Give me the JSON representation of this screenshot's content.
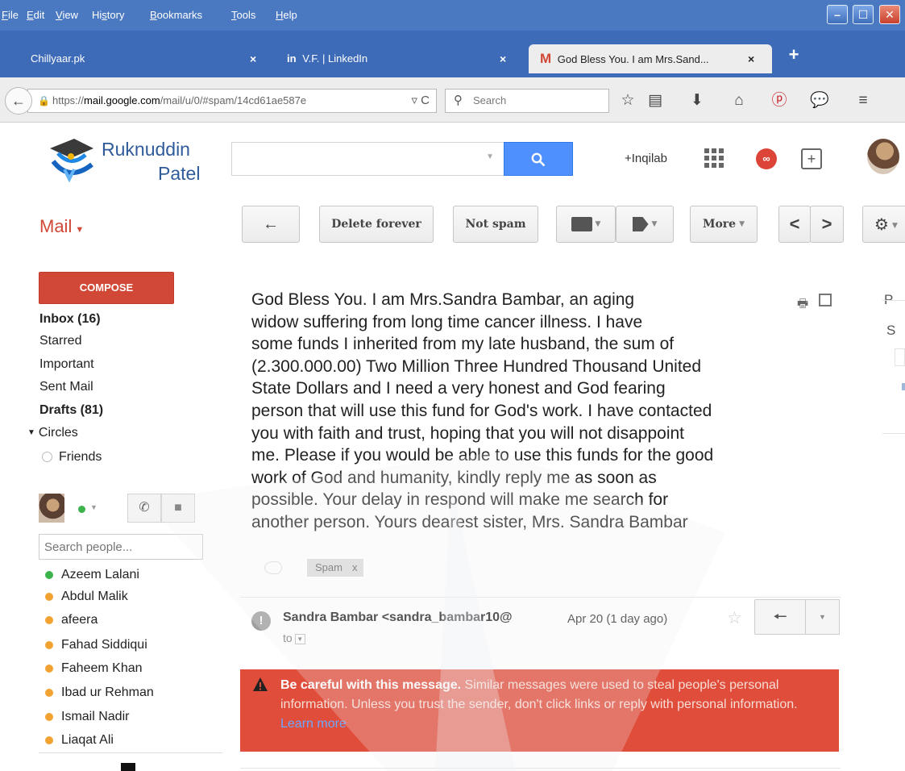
{
  "menubar": {
    "items": [
      {
        "label": "File",
        "key": "F",
        "rest": "ile"
      },
      {
        "label": "Edit",
        "key": "E",
        "rest": "dit"
      },
      {
        "label": "View",
        "key": "V",
        "rest": "iew"
      },
      {
        "label": "History",
        "key": "s",
        "pre": "Hi",
        "rest": "tory"
      },
      {
        "label": "Bookmarks",
        "key": "B",
        "rest": "ookmarks"
      },
      {
        "label": "Tools",
        "key": "T",
        "rest": "ools"
      },
      {
        "label": "Help",
        "key": "H",
        "rest": "elp"
      }
    ],
    "window_buttons": {
      "minimize": "–",
      "maximize": "☐",
      "close": "✕"
    }
  },
  "tabs": [
    {
      "label": "Chillyaar.pk",
      "close": "×",
      "active": false
    },
    {
      "badge": "in",
      "label": "V.F. | LinkedIn",
      "close": "×",
      "active": false
    },
    {
      "badge": "M",
      "label": "God Bless You. I am Mrs.Sand...",
      "close": "×",
      "active": true
    }
  ],
  "newtab_label": "+",
  "navbar": {
    "back": "←",
    "url": {
      "scheme": "https://",
      "host": "mail.google.com",
      "path": "/mail/u/0/#spam/14cd61ae587e"
    },
    "url_controls": "▿ C",
    "search_placeholder": "Search",
    "icons": [
      "star-icon",
      "reading-list-icon",
      "download-icon",
      "home-icon",
      "pinterest-icon",
      "chat-icon",
      "menu-icon"
    ]
  },
  "header": {
    "logo_line1": "Ruknuddin",
    "logo_line2": "Patel",
    "search_value": "",
    "plus_name": "+Inqilab"
  },
  "toolbar": {
    "mail_label": "Mail",
    "back_label": "←",
    "delete_label": "Delete forever",
    "notspam_label": "Not spam",
    "more_label": "More",
    "prev_label": "<",
    "next_label": ">"
  },
  "leftnav": {
    "compose_label": "COMPOSE",
    "folders": [
      {
        "label": "Inbox (16)",
        "bold": true
      },
      {
        "label": "Starred",
        "bold": false
      },
      {
        "label": "Important",
        "bold": false
      },
      {
        "label": "Sent Mail",
        "bold": false
      },
      {
        "label": "Drafts (81)",
        "bold": true
      }
    ],
    "circles_label": "Circles",
    "friends_label": "Friends",
    "people_search_placeholder": "Search people...",
    "contacts": [
      {
        "name": "Azeem Lalani",
        "status": "online"
      },
      {
        "name": "Abdul Malik",
        "status": "idle"
      },
      {
        "name": "afeera",
        "status": "idle"
      },
      {
        "name": "Fahad Siddiqui",
        "status": "idle"
      },
      {
        "name": "Faheem Khan",
        "status": "idle"
      },
      {
        "name": "Ibad ur Rehman",
        "status": "idle"
      },
      {
        "name": "Ismail Nadir",
        "status": "idle"
      },
      {
        "name": "Liaqat Ali",
        "status": "idle"
      }
    ]
  },
  "message": {
    "body_lines": [
      "God Bless You. I am Mrs.Sandra Bambar, an aging",
      "widow suffering from long time cancer illness. I have",
      "some funds I inherited from my late husband, the sum of",
      "(2.300.000.00) Two Million Three Hundred Thousand United",
      "State Dollars and I need a very honest and God fearing",
      "person that will use this fund for God's work. I have contacted",
      "you with faith and trust, hoping that you will not disappoint",
      "me. Please if you would be able to use this funds for the good",
      "work of God and humanity, kindly reply me as soon as",
      "possible. Your delay in respond will make me search for",
      "another person. Yours dearest sister, Mrs. Sandra Bambar"
    ],
    "label": "Spam",
    "label_remove": "x",
    "sender": "Sandra Bambar <sandra_bambar10@",
    "to": "to",
    "date": "Apr 20 (1 day ago)",
    "warning_title": "Be careful with this message.",
    "warning_text": " Similar messages were used to steal people's personal information. Unless you trust the sender, don't click links or reply with personal information.",
    "warning_link": "Learn more"
  },
  "right_panel": {
    "p": "P",
    "s": "S"
  },
  "colors": {
    "menubar": "#4a79c2",
    "tabstrip": "#3d6bb8",
    "compose": "#d14836",
    "search_button": "#4d90fe",
    "warning": "#e04e3b",
    "online": "#3cb44b",
    "idle": "#f2a230"
  }
}
